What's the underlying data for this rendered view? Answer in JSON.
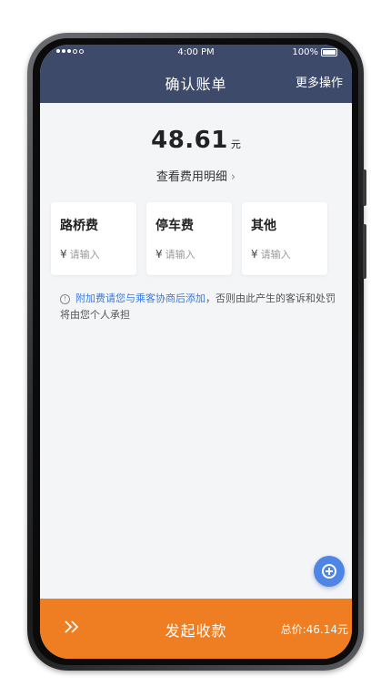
{
  "status_bar": {
    "time": "4:00 PM",
    "battery": "100%"
  },
  "header": {
    "title": "确认账单",
    "more_actions": "更多操作"
  },
  "bill": {
    "amount": "48.61",
    "unit": "元",
    "detail_link": "查看费用明细",
    "chevron": "›"
  },
  "fees": [
    {
      "label": "路桥费",
      "currency": "¥",
      "placeholder": "请输入"
    },
    {
      "label": "停车费",
      "currency": "¥",
      "placeholder": "请输入"
    },
    {
      "label": "其他",
      "currency": "¥",
      "placeholder": "请输入"
    }
  ],
  "notice": {
    "icon": "info-icon",
    "highlight": "附加费请您与乘客协商后添加",
    "rest": "，否则由此产生的客诉和处罚将由您个人承担"
  },
  "fab": {
    "icon": "plus-circle-icon"
  },
  "bottom_bar": {
    "action_label": "发起收款",
    "total": "总价:46.14元",
    "arrow_icon": "double-chevron-right-icon"
  },
  "colors": {
    "header_bg": "#3e4a69",
    "accent_orange": "#ef7d22",
    "link_blue": "#3b7ad9",
    "fab_blue": "#4f86e6"
  }
}
